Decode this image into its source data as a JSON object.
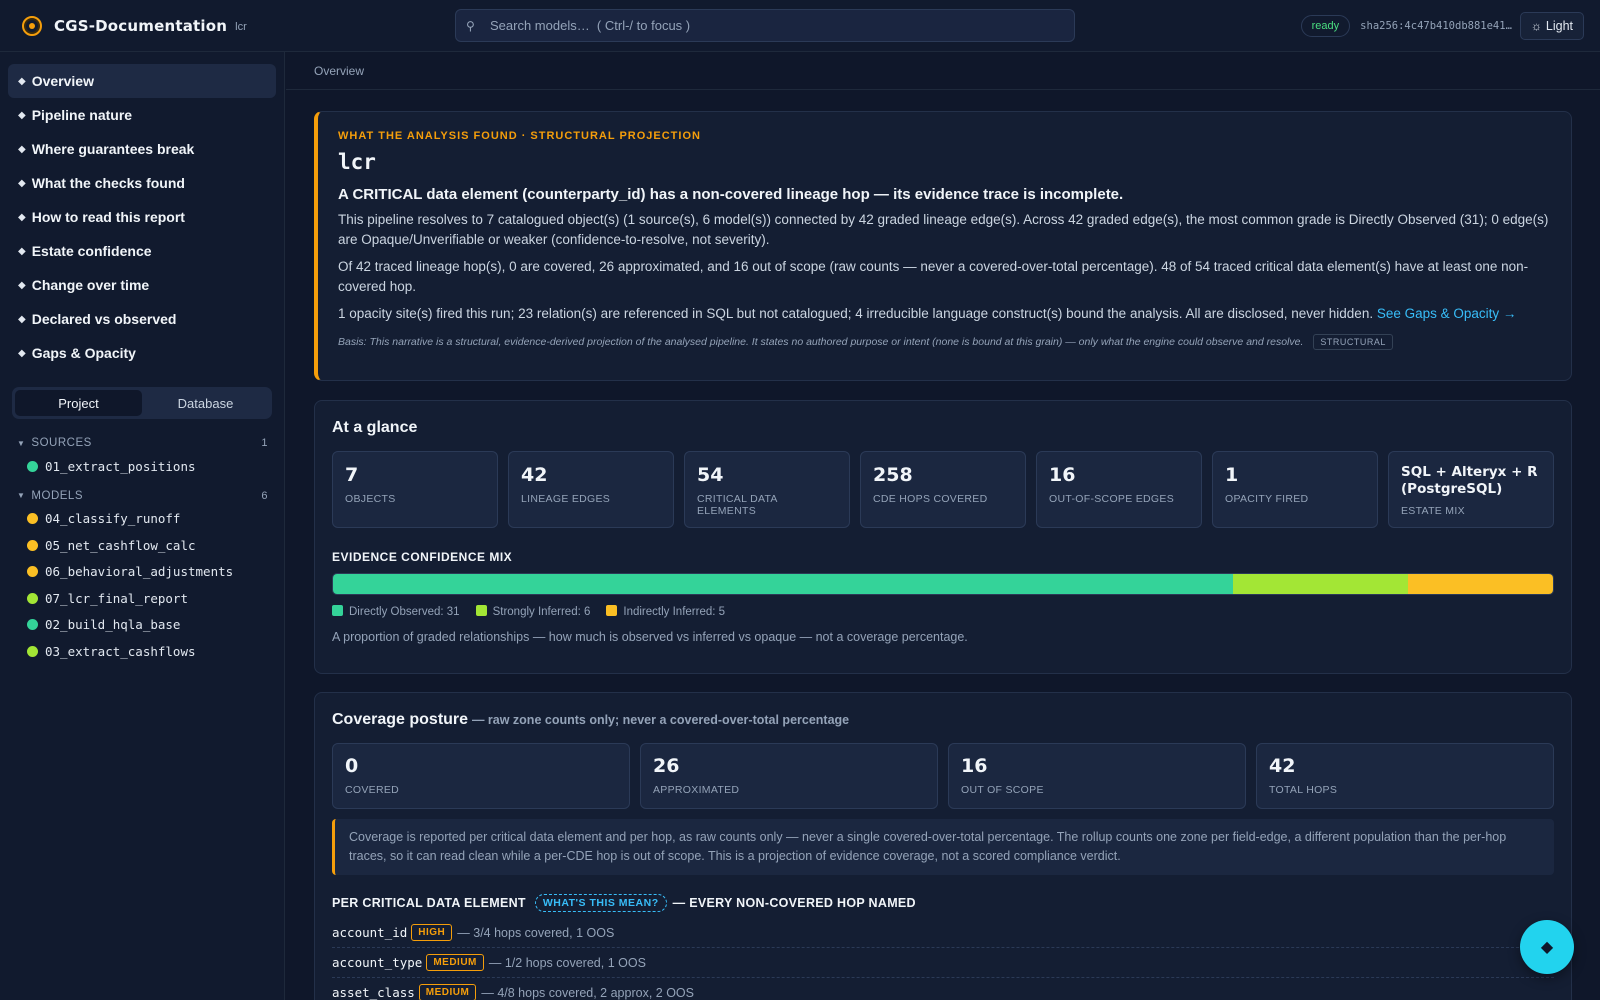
{
  "header": {
    "title": "CGS-Documentation",
    "subtitle": "lcr",
    "search_placeholder": "Search models…  ( Ctrl-/ to focus )",
    "status": "ready",
    "sha": "sha256:4c47b410db881e41…",
    "theme_label": "Light"
  },
  "sidebar": {
    "nav": [
      {
        "label": "Overview"
      },
      {
        "label": "Pipeline nature"
      },
      {
        "label": "Where guarantees break"
      },
      {
        "label": "What the checks found"
      },
      {
        "label": "How to read this report"
      },
      {
        "label": "Estate confidence"
      },
      {
        "label": "Change over time"
      },
      {
        "label": "Declared vs observed"
      },
      {
        "label": "Gaps & Opacity"
      }
    ],
    "segments": [
      "Project",
      "Database"
    ],
    "sources": {
      "label": "SOURCES",
      "count": "1",
      "items": [
        {
          "name": "01_extract_positions",
          "color": "#34d399"
        }
      ]
    },
    "models": {
      "label": "MODELS",
      "count": "6",
      "items": [
        {
          "name": "04_classify_runoff",
          "color": "#fbbf24"
        },
        {
          "name": "05_net_cashflow_calc",
          "color": "#fbbf24"
        },
        {
          "name": "06_behavioral_adjustments",
          "color": "#fbbf24"
        },
        {
          "name": "07_lcr_final_report",
          "color": "#a3e635"
        },
        {
          "name": "02_build_hqla_base",
          "color": "#34d399"
        },
        {
          "name": "03_extract_cashflows",
          "color": "#a3e635"
        }
      ]
    }
  },
  "breadcrumb": "Overview",
  "hero": {
    "eyebrow": "WHAT THE ANALYSIS FOUND · STRUCTURAL PROJECTION",
    "title": "lcr",
    "headline": "A CRITICAL data element (counterparty_id) has a non-covered lineage hop — its evidence trace is incomplete.",
    "p1": "This pipeline resolves to 7 catalogued object(s) (1 source(s), 6 model(s)) connected by 42 graded lineage edge(s). Across 42 graded edge(s), the most common grade is Directly Observed (31); 0 edge(s) are Opaque/Unverifiable or weaker (confidence-to-resolve, not severity).",
    "p2": "Of 42 traced lineage hop(s), 0 are covered, 26 approximated, and 16 out of scope (raw counts — never a covered-over-total percentage). 48 of 54 traced critical data element(s) have at least one non-covered hop.",
    "p3": "1 opacity site(s) fired this run; 23 relation(s) are referenced in SQL but not catalogued; 4 irreducible language construct(s) bound the analysis. All are disclosed, never hidden.",
    "p3_link": "See Gaps & Opacity →",
    "basis": "Basis: This narrative is a structural, evidence-derived projection of the analysed pipeline. It states no authored purpose or intent (none is bound at this grain) — only what the engine could observe and resolve.",
    "basis_tag": "STRUCTURAL"
  },
  "glance": {
    "title": "At a glance",
    "stats": [
      {
        "value": "7",
        "label": "OBJECTS"
      },
      {
        "value": "42",
        "label": "LINEAGE EDGES"
      },
      {
        "value": "54",
        "label": "CRITICAL DATA ELEMENTS"
      },
      {
        "value": "258",
        "label": "CDE HOPS COVERED"
      },
      {
        "value": "16",
        "label": "OUT-OF-SCOPE EDGES"
      },
      {
        "value": "1",
        "label": "OPACITY FIRED"
      },
      {
        "value": "SQL + Alteryx + R (PostgreSQL)",
        "label": "ESTATE MIX"
      }
    ],
    "mix_title": "EVIDENCE CONFIDENCE MIX",
    "mix": [
      {
        "label": "Directly Observed: 31",
        "value": 31,
        "color": "#34d399"
      },
      {
        "label": "Strongly Inferred: 6",
        "value": 6,
        "color": "#a3e635"
      },
      {
        "label": "Indirectly Inferred: 5",
        "value": 5,
        "color": "#fbbf24"
      }
    ],
    "note": "A proportion of graded relationships — how much is observed vs inferred vs opaque — not a coverage percentage."
  },
  "coverage": {
    "title": "Coverage posture",
    "subtitle": "— raw zone counts only; never a covered-over-total percentage",
    "stats": [
      {
        "value": "0",
        "label": "COVERED"
      },
      {
        "value": "26",
        "label": "APPROXIMATED"
      },
      {
        "value": "16",
        "label": "OUT OF SCOPE"
      },
      {
        "value": "42",
        "label": "TOTAL HOPS"
      }
    ],
    "callout": "Coverage is reported per critical data element and per hop, as raw counts only — never a single covered-over-total percentage. The rollup counts one zone per field-edge, a different population than the per-hop traces, so it can read clean while a per-CDE hop is out of scope. This is a projection of evidence coverage, not a scored compliance verdict.",
    "cde_title": "PER CRITICAL DATA ELEMENT",
    "cde_help": "WHAT'S THIS MEAN?",
    "cde_suffix": "— EVERY NON-COVERED HOP NAMED",
    "rows": [
      {
        "name": "account_id",
        "severity": "HIGH",
        "detail": "— 3/4 hops covered, 1 OOS"
      },
      {
        "name": "account_type",
        "severity": "MEDIUM",
        "detail": "— 1/2 hops covered, 1 OOS"
      },
      {
        "name": "asset_class",
        "severity": "MEDIUM",
        "detail": "— 4/8 hops covered, 2 approx, 2 OOS"
      }
    ]
  }
}
